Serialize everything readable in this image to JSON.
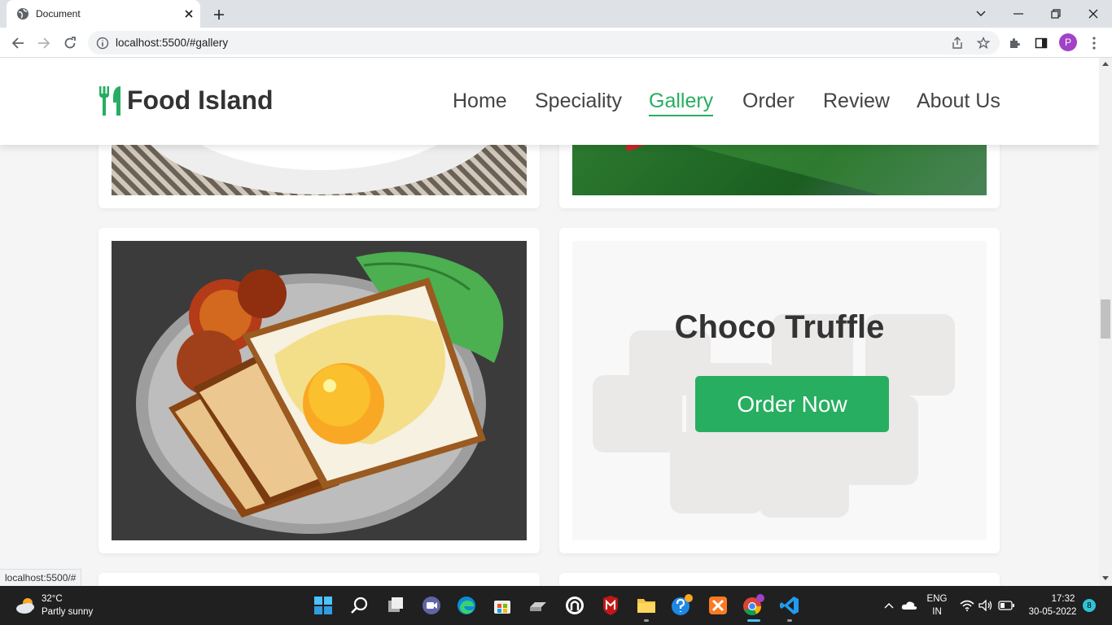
{
  "browser": {
    "tab_title": "Document",
    "url": "localhost:5500/#gallery",
    "profile_initial": "P",
    "status_url": "localhost:5500/#"
  },
  "site": {
    "logo_text": "Food Island",
    "nav": [
      {
        "label": "Home"
      },
      {
        "label": "Speciality"
      },
      {
        "label": "Gallery",
        "active": true
      },
      {
        "label": "Order"
      },
      {
        "label": "Review"
      },
      {
        "label": "About Us"
      }
    ],
    "accent_color": "#27ae60",
    "gallery": {
      "overlay_title": "Choco Truffle",
      "order_button": "Order Now"
    }
  },
  "taskbar": {
    "weather_temp": "32°C",
    "weather_desc": "Partly sunny",
    "lang_top": "ENG",
    "lang_bottom": "IN",
    "time": "17:32",
    "date": "30-05-2022",
    "notification_count": "8",
    "apps": [
      "start-icon",
      "search-icon",
      "task-view-icon",
      "teams-icon",
      "edge-icon",
      "store-icon",
      "drive-icon",
      "mcafee-shield-icon",
      "security-icon",
      "file-explorer-icon",
      "help-icon",
      "xampp-icon",
      "chrome-icon",
      "vscode-icon"
    ]
  }
}
